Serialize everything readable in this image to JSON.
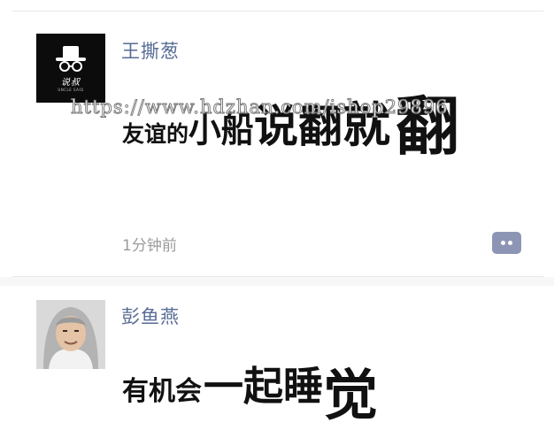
{
  "watermark": "https://www.hdzhan.com/ishop29896",
  "posts": [
    {
      "author": "王撕葱",
      "avatar": {
        "icon": "hat-glasses-logo-avatar",
        "brand": "说叔",
        "tagline": "UNCLE SAID"
      },
      "message_parts": [
        "友谊的",
        "小船",
        "说翻",
        "就",
        "翻"
      ],
      "time": "1分钟前",
      "comment_icon": "comment-bubble-icon"
    },
    {
      "author": "彭鱼燕",
      "avatar": {
        "icon": "hooded-person-photo-avatar"
      },
      "message_parts": [
        "有机会",
        "一起睡",
        "觉"
      ]
    }
  ],
  "colors": {
    "name": "#576b95",
    "time": "#9b9b9b",
    "comment_button": "#8c96b4",
    "divider": "#e8e8e8"
  }
}
